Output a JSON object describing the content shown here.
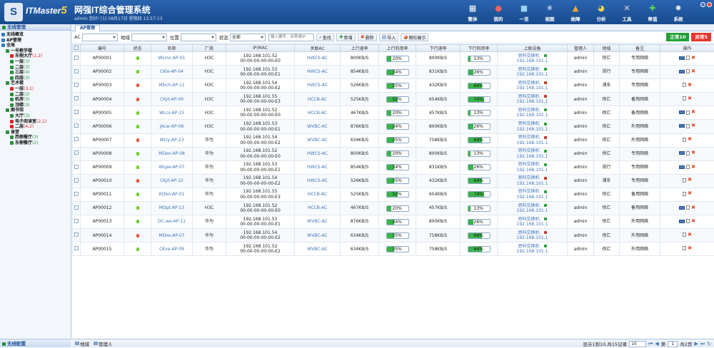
{
  "header": {
    "logo_text": "S",
    "brand": "ITMaster",
    "brand_num": "5",
    "system_name": "网强IT综合管理系统",
    "user_info": "admin 您好! [1] 08月17日 星期四 13:57:13"
  },
  "nav": [
    {
      "label": "整体",
      "icon": "▦",
      "color": "#ffffff"
    },
    {
      "label": "我的",
      "icon": "●",
      "color": "#f06262"
    },
    {
      "label": "一览",
      "icon": "■",
      "color": "#9ad0f2"
    },
    {
      "label": "视图",
      "icon": "✳",
      "color": "#ffffff"
    },
    {
      "label": "故障",
      "icon": "▲",
      "color": "#f5a623"
    },
    {
      "label": "分析",
      "icon": "◕",
      "color": "#f5d04a"
    },
    {
      "label": "工具",
      "icon": "✕",
      "color": "#dcdcdc"
    },
    {
      "label": "帮值",
      "icon": "✚",
      "color": "#5ad35a"
    },
    {
      "label": "系统",
      "icon": "✹",
      "color": "#e8e8e8"
    }
  ],
  "sidebar": {
    "title": "无线管理",
    "footer": "无线配置",
    "tree": [
      {
        "label": "无线概览",
        "count": "",
        "count_red": false,
        "level": 1,
        "color": "#2e7bd1"
      },
      {
        "label": "AP管理",
        "count": "",
        "count_red": false,
        "level": 1,
        "color": "#2e7bd1"
      },
      {
        "label": "全局",
        "count": "",
        "count_red": false,
        "level": 1,
        "color": "#2e7bd1"
      },
      {
        "label": "一号教学楼",
        "count": "",
        "count_red": false,
        "level": 2,
        "color": "#2a8f3e"
      },
      {
        "label": "东侧大厅",
        "count": "(1,2)",
        "count_red": true,
        "level": 3,
        "color": "#d22"
      },
      {
        "label": "一层",
        "count": "(3)",
        "count_red": false,
        "level": 3,
        "color": "#2a8f3e"
      },
      {
        "label": "二层",
        "count": "(3)",
        "count_red": false,
        "level": 3,
        "color": "#2a8f3e"
      },
      {
        "label": "三层",
        "count": "(4)",
        "count_red": false,
        "level": 3,
        "color": "#2a8f3e"
      },
      {
        "label": "四层",
        "count": "(3)",
        "count_red": false,
        "level": 3,
        "color": "#2a8f3e"
      },
      {
        "label": "艺术楼",
        "count": "",
        "count_red": false,
        "level": 2,
        "color": "#2a8f3e"
      },
      {
        "label": "一层",
        "count": "(3,1)",
        "count_red": true,
        "level": 3,
        "color": "#d22"
      },
      {
        "label": "二层",
        "count": "(3)",
        "count_red": false,
        "level": 3,
        "color": "#2a8f3e"
      },
      {
        "label": "机房",
        "count": "(3)",
        "count_red": false,
        "level": 3,
        "color": "#2a8f3e"
      },
      {
        "label": "顶楼",
        "count": "(3)",
        "count_red": false,
        "level": 3,
        "color": "#2a8f3e"
      },
      {
        "label": "图书馆",
        "count": "",
        "count_red": false,
        "level": 2,
        "color": "#2a8f3e"
      },
      {
        "label": "大厅",
        "count": "(3)",
        "count_red": false,
        "level": 3,
        "color": "#2a8f3e"
      },
      {
        "label": "电子阅读室",
        "count": "(2,1)",
        "count_red": true,
        "level": 3,
        "color": "#d22"
      },
      {
        "label": "二层",
        "count": "(4,2)",
        "count_red": true,
        "level": 3,
        "color": "#d22"
      },
      {
        "label": "食堂",
        "count": "",
        "count_red": false,
        "level": 2,
        "color": "#2a8f3e"
      },
      {
        "label": "西侧餐厅",
        "count": "(3)",
        "count_red": false,
        "level": 3,
        "color": "#2a8f3e"
      },
      {
        "label": "东侧餐厅",
        "count": "(2)",
        "count_red": false,
        "level": 3,
        "color": "#2a8f3e"
      }
    ]
  },
  "tab": "AP管理",
  "toolbar": {
    "ac_label": "AC",
    "area_label": "地域",
    "location_label": "位置",
    "status_label": "状态",
    "status_value": "全部",
    "search_placeholder": "输入编号、名称或IP",
    "btn_search": "查找",
    "btn_add": "新增",
    "btn_delete": "删除",
    "btn_import": "导入",
    "btn_chart": "图形展示",
    "normal_label": "正常10",
    "error_label": "异常5"
  },
  "columns": [
    "编号",
    "状态",
    "名称",
    "厂商",
    "IP/MAC",
    "关联AC",
    "上行速率",
    "上行利用率",
    "下行速率",
    "下行利用率",
    "上联设备",
    "管理人",
    "地域",
    "备注",
    "操作"
  ],
  "rows": [
    {
      "id": "AP00001",
      "status": "ok",
      "name": "WLmc-AP-01",
      "vendor": "H3C",
      "ip": "192.168.101.52",
      "mac": "00-00-00-00-00-E0",
      "ac": "HWCS-AC",
      "up": "800KB/S",
      "up_pct": 20,
      "up_label": "20%",
      "down": "800KB/S",
      "down_pct": 13,
      "down_label": "13%",
      "dev": "思科交换机",
      "dev_ip": "192.168.101.1",
      "admin": "admin",
      "area": "徐汇",
      "note": "专用网络",
      "mon": true
    },
    {
      "id": "AP00002",
      "status": "ok",
      "name": "CKle-AP-04",
      "vendor": "H3C",
      "ip": "192.168.101.53",
      "mac": "00-00-00-00-00-E1",
      "ac": "HWCS-AC",
      "up": "854KB/S",
      "up_pct": 34,
      "up_label": "34%",
      "down": "831KB/S",
      "down_pct": 26,
      "down_label": "26%",
      "dev": "思科交换机",
      "dev_ip": "192.168.101.1",
      "admin": "admin",
      "area": "闵行",
      "note": "专用网络",
      "mon": true
    },
    {
      "id": "AP00003",
      "status": "err",
      "name": "MDch-AP-11",
      "vendor": "H3C",
      "ip": "192.168.101.54",
      "mac": "00-00-00-00-00-E2",
      "ac": "HWCS-AC",
      "up": "526KB/S",
      "up_pct": 35,
      "up_label": "35%",
      "down": "432KB/S",
      "down_pct": 64,
      "down_label": "64%",
      "dev": "思科交换机",
      "dev_ip": "192.168.101.1",
      "admin": "admin",
      "area": "浦东",
      "note": "专用网络",
      "mon": false
    },
    {
      "id": "AP00004",
      "status": "err",
      "name": "CKyt-AP-09",
      "vendor": "H3C",
      "ip": "192.168.101.55",
      "mac": "00-00-00-00-00-E3",
      "ac": "HCCB-AC",
      "up": "525KB/S",
      "up_pct": 52,
      "up_label": "52%",
      "down": "654KB/S",
      "down_pct": 74,
      "down_label": "74%",
      "dev": "思科交换机",
      "dev_ip": "192.168.101.1",
      "admin": "admin",
      "area": "徐汇",
      "note": "备用网络",
      "mon": false
    },
    {
      "id": "AP00005",
      "status": "ok",
      "name": "WLcs-AP-15",
      "vendor": "H3C",
      "ip": "192.168.101.52",
      "mac": "00-00-00-00-00-E0",
      "ac": "HCCB-AC",
      "up": "467KB/S",
      "up_pct": 20,
      "up_label": "20%",
      "down": "457KB/S",
      "down_pct": 13,
      "down_label": "13%",
      "dev": "思科交换机",
      "dev_ip": "192.168.101.1",
      "admin": "admin",
      "area": "徐汇",
      "note": "备用网络",
      "mon": true
    },
    {
      "id": "AP00006",
      "status": "ok",
      "name": "JAcw-AP-08",
      "vendor": "H3C",
      "ip": "192.168.101.53",
      "mac": "00-00-00-00-00-E1",
      "ac": "WVBC-AC",
      "up": "876KB/S",
      "up_pct": 34,
      "up_label": "34%",
      "down": "800KB/S",
      "down_pct": 26,
      "down_label": "26%",
      "dev": "思科交换机",
      "dev_ip": "192.168.101.1",
      "admin": "admin",
      "area": "徐汇",
      "note": "外用网络",
      "mon": true
    },
    {
      "id": "AP00007",
      "status": "err",
      "name": "WLly-AP-23",
      "vendor": "华为",
      "ip": "192.168.101.54",
      "mac": "00-00-00-00-00-E2",
      "ac": "WVBC-AC",
      "up": "634KB/S",
      "up_pct": 35,
      "up_label": "35%",
      "down": "758KB/S",
      "down_pct": 64,
      "down_label": "64%",
      "dev": "思科交换机",
      "dev_ip": "192.168.101.1",
      "admin": "admin",
      "area": "徐汇",
      "note": "外用网络",
      "mon": false
    },
    {
      "id": "AP00008",
      "status": "ok",
      "name": "MDen-AP-08",
      "vendor": "华为",
      "ip": "192.168.101.52",
      "mac": "00-00-00-00-00-E0",
      "ac": "HWCS-AC",
      "up": "800KB/S",
      "up_pct": 20,
      "up_label": "20%",
      "down": "800KB/S",
      "down_pct": 13,
      "down_label": "13%",
      "dev": "思科交换机",
      "dev_ip": "192.168.101.1",
      "admin": "admin",
      "area": "徐汇",
      "note": "专用网络",
      "mon": true
    },
    {
      "id": "AP00009",
      "status": "ok",
      "name": "WLpe-AP-07",
      "vendor": "华为",
      "ip": "192.168.101.53",
      "mac": "00-00-00-00-00-E1",
      "ac": "HWCS-AC",
      "up": "854KB/S",
      "up_pct": 34,
      "up_label": "34%",
      "down": "831KB/S",
      "down_pct": 26,
      "down_label": "26%",
      "dev": "思科交换机",
      "dev_ip": "192.168.101.1",
      "admin": "admin",
      "area": "闵行",
      "note": "专用网络",
      "mon": true
    },
    {
      "id": "AP00010",
      "status": "err",
      "name": "CKyt-AP-22",
      "vendor": "华为",
      "ip": "192.168.101.54",
      "mac": "00-00-00-00-00-E2",
      "ac": "HWCS-AC",
      "up": "526KB/S",
      "up_pct": 35,
      "up_label": "35%",
      "down": "432KB/S",
      "down_pct": 64,
      "down_label": "64%",
      "dev": "思科交换机",
      "dev_ip": "192.168.101.1",
      "admin": "admin",
      "area": "浦东",
      "note": "专用网络",
      "mon": false
    },
    {
      "id": "AP00011",
      "status": "ok",
      "name": "KDbn-AP-01",
      "vendor": "华为",
      "ip": "192.168.101.55",
      "mac": "00-00-00-00-00-E3",
      "ac": "HCCB-AC",
      "up": "525KB/S",
      "up_pct": 52,
      "up_label": "52%",
      "down": "654KB/S",
      "down_pct": 74,
      "down_label": "74%",
      "dev": "思科交换机",
      "dev_ip": "192.168.101.1",
      "admin": "admin",
      "area": "徐汇",
      "note": "备用网络",
      "mon": false
    },
    {
      "id": "AP00012",
      "status": "ok",
      "name": "MDpt-AP-13",
      "vendor": "H3C",
      "ip": "192.168.101.52",
      "mac": "00-00-00-00-00-E0",
      "ac": "HCCB-AC",
      "up": "467KB/S",
      "up_pct": 20,
      "up_label": "20%",
      "down": "457KB/S",
      "down_pct": 13,
      "down_label": "13%",
      "dev": "思科交换机",
      "dev_ip": "192.168.101.1",
      "admin": "admin",
      "area": "徐汇",
      "note": "备用网络",
      "mon": true
    },
    {
      "id": "AP00013",
      "status": "ok",
      "name": "DC-we-AP-11",
      "vendor": "华为",
      "ip": "192.168.101.53",
      "mac": "00-00-00-00-00-E1",
      "ac": "WVBC-AC",
      "up": "876KB/S",
      "up_pct": 34,
      "up_label": "34%",
      "down": "800KB/S",
      "down_pct": 26,
      "down_label": "26%",
      "dev": "思科交换机",
      "dev_ip": "192.168.101.1",
      "admin": "admin",
      "area": "徐汇",
      "note": "外用网络",
      "mon": true
    },
    {
      "id": "AP00014",
      "status": "err",
      "name": "MDox-AP-07",
      "vendor": "华为",
      "ip": "192.168.101.54",
      "mac": "00-00-00-00-00-E2",
      "ac": "WVBC-AC",
      "up": "634KB/S",
      "up_pct": 35,
      "up_label": "35%",
      "down": "758KB/S",
      "down_pct": 64,
      "down_label": "64%",
      "dev": "思科交换机",
      "dev_ip": "192.168.101.1",
      "admin": "admin",
      "area": "徐汇",
      "note": "外用网络",
      "mon": false
    },
    {
      "id": "AP00015",
      "status": "ok",
      "name": "CKve-AP-09",
      "vendor": "华为",
      "ip": "192.168.101.52",
      "mac": "00-00-00-00-00-E2",
      "ac": "WVBC-AC",
      "up": "634KB/S",
      "up_pct": 35,
      "up_label": "35%",
      "down": "758KB/S",
      "down_pct": 64,
      "down_label": "64%",
      "dev": "思科交换机",
      "dev_ip": "192.168.101.1",
      "admin": "admin",
      "area": "徐汇",
      "note": "外用网络",
      "mon": false
    }
  ],
  "footer": {
    "area_btn": "地域",
    "admin_btn": "管理人",
    "records": "显示1到10,共15记录",
    "page_size": "10",
    "page_no": "1",
    "page_total": "共2页"
  },
  "colors": {
    "ok": "#6ccf2e",
    "err": "#f0503c",
    "upl_ok": "#2e9b3e",
    "upl_err": "#c0392b"
  }
}
